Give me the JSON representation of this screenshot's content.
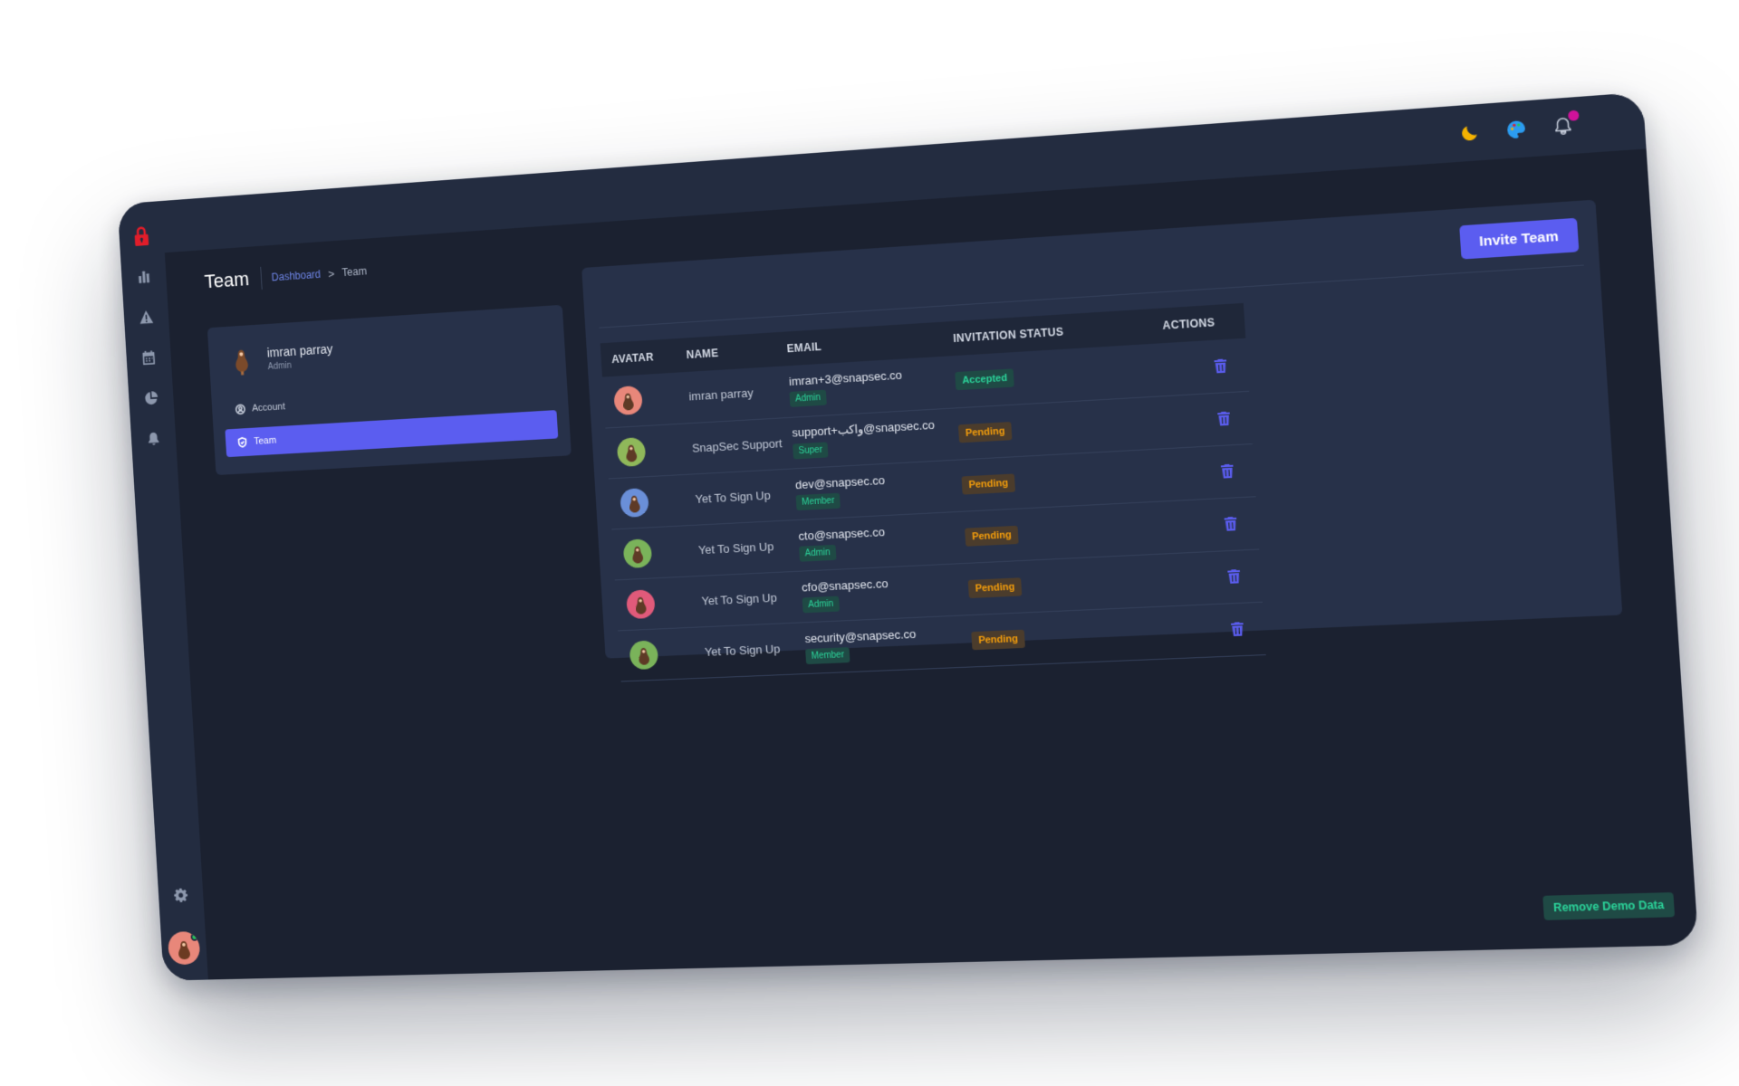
{
  "colors": {
    "background": "#1b2130",
    "panel": "#232c40",
    "card": "#273149",
    "accent": "#5b5df0",
    "success": "#2bd49a",
    "warning": "#f59e0b",
    "logo": "#e11d2a"
  },
  "sidebar": {
    "logo_icon": "lock-icon",
    "items": [
      {
        "icon": "bar-chart-icon"
      },
      {
        "icon": "warning-triangle-icon"
      },
      {
        "icon": "calendar-icon"
      },
      {
        "icon": "pie-chart-icon"
      },
      {
        "icon": "bell-icon"
      }
    ],
    "bottom_icon": "gear-icon",
    "user_avatar_status": "online"
  },
  "topbar": {
    "icons": [
      "moon-icon",
      "palette-icon",
      "bell-icon"
    ],
    "has_notification": true
  },
  "header": {
    "title": "Team",
    "breadcrumb": {
      "link": "Dashboard",
      "separator": ">",
      "current": "Team"
    }
  },
  "profile": {
    "name": "imran parray",
    "role": "Admin",
    "menu": [
      {
        "label": "Account",
        "icon": "user-circle-icon",
        "active": false
      },
      {
        "label": "Team",
        "icon": "shield-check-icon",
        "active": true
      }
    ]
  },
  "table": {
    "invite_label": "Invite Team",
    "columns": [
      "AVATAR",
      "NAME",
      "EMAIL",
      "INVITATION STATUS",
      "ACTIONS"
    ],
    "rows": [
      {
        "avatar_color": "#e8877a",
        "name": "imran parray",
        "email": "imran+3@snapsec.co",
        "role": "Admin",
        "status": "Accepted"
      },
      {
        "avatar_color": "#8fb85a",
        "name": "SnapSec Support",
        "email": "support+واکب@snapsec.co",
        "role": "Super",
        "status": "Pending"
      },
      {
        "avatar_color": "#6a8fd8",
        "name": "Yet To Sign Up",
        "email": "dev@snapsec.co",
        "role": "Member",
        "status": "Pending"
      },
      {
        "avatar_color": "#7ab35a",
        "name": "Yet To Sign Up",
        "email": "cto@snapsec.co",
        "role": "Admin",
        "status": "Pending"
      },
      {
        "avatar_color": "#e05a7a",
        "name": "Yet To Sign Up",
        "email": "cfo@snapsec.co",
        "role": "Admin",
        "status": "Pending"
      },
      {
        "avatar_color": "#7ab35a",
        "name": "Yet To Sign Up",
        "email": "security@snapsec.co",
        "role": "Member",
        "status": "Pending"
      }
    ],
    "action_icon": "trash-icon"
  },
  "footer": {
    "remove_demo_label": "Remove Demo Data"
  }
}
